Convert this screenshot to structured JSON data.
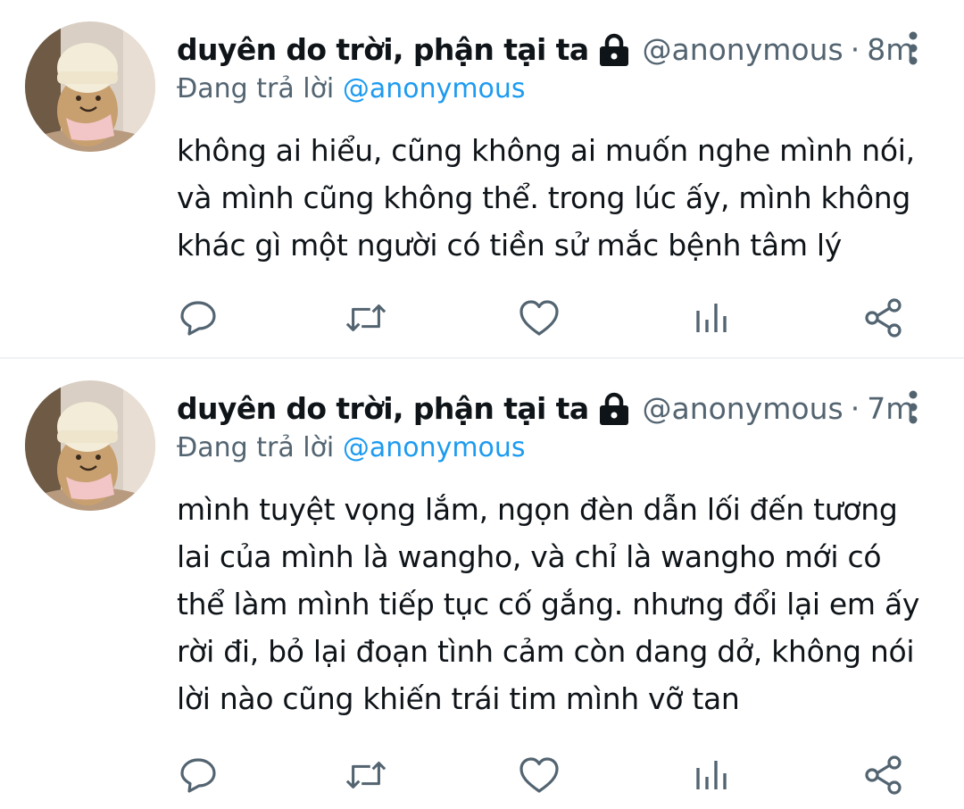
{
  "tweets": [
    {
      "display_name": "duyên do trời, phận tại ta",
      "handle": "@anonymous",
      "separator": "·",
      "time": "8m",
      "replying_prefix": "Đang trả lời",
      "replying_to": "@anonymous",
      "text_lines": [
        "không ai hiểu, cũng không ai muốn nghe mình nói,",
        "và mình cũng không thể. trong lúc ấy, mình không",
        "khác gì một người có tiền sử mắc bệnh tâm lý"
      ]
    },
    {
      "display_name": "duyên do trời, phận tại ta",
      "handle": "@anonymous",
      "separator": "·",
      "time": "7m",
      "replying_prefix": "Đang trả lời",
      "replying_to": "@anonymous",
      "text_lines": [
        "mình tuyệt vọng lắm, ngọn đèn dẫn lối đến tương",
        "lai của mình là wangho, và chỉ là wangho mới có",
        "thể làm mình tiếp tục cố gắng. nhưng đổi lại em ấy",
        "rời đi, bỏ lại đoạn tình cảm còn dang dở, không nói",
        "lời nào cũng khiến trái tim mình vỡ tan"
      ]
    }
  ],
  "icons": {
    "protected": "lock-icon",
    "more": "more-vertical-icon",
    "reply": "reply-icon",
    "retweet": "retweet-icon",
    "like": "heart-icon",
    "views": "analytics-icon",
    "share": "share-icon"
  },
  "colors": {
    "text": "#0f1419",
    "secondary": "#536471",
    "mention": "#1d9bf0",
    "divider": "#eff3f4"
  }
}
